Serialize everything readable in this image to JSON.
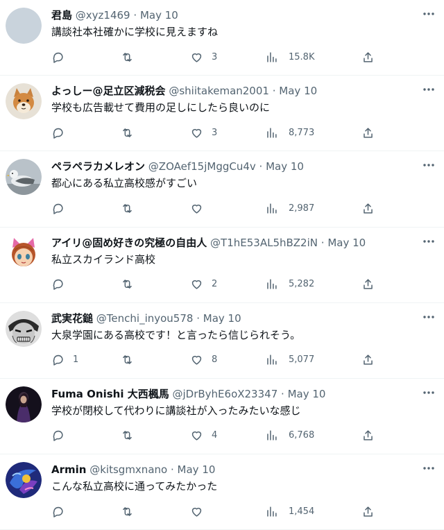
{
  "tweets": [
    {
      "name": "君島",
      "handle": "@xyz1469",
      "sep": "·",
      "date": "May 10",
      "text": "講談社本社確かに学校に見えますね",
      "replies": "",
      "retweets": "",
      "likes": "3",
      "views": "15.8K",
      "avatar": "grey-circle"
    },
    {
      "name": "よっしー@足立区減税会",
      "handle": "@shiitakeman2001",
      "sep": "·",
      "date": "May 10",
      "text": "学校も広告載せて費用の足しにしたら良いのに",
      "replies": "",
      "retweets": "",
      "likes": "3",
      "views": "8,773",
      "avatar": "shiba-dog"
    },
    {
      "name": "ペラペラカメレオン",
      "handle": "@ZOAef15jMggCu4v",
      "sep": "·",
      "date": "May 10",
      "text": "都心にある私立高校感がすごい",
      "replies": "",
      "retweets": "",
      "likes": "",
      "views": "2,987",
      "avatar": "seagull"
    },
    {
      "name": "アイリ@固め好きの究極の自由人",
      "handle": "@T1hE53AL5hBZ2iN",
      "sep": "·",
      "date": "May 10",
      "text": "私立スカイランド高校",
      "replies": "",
      "retweets": "",
      "likes": "2",
      "views": "5,282",
      "avatar": "anime-cat-girl"
    },
    {
      "name": "武実花鎚",
      "handle": "@Tenchi_inyou578",
      "sep": "·",
      "date": "May 10",
      "text": "大泉学園にある高校です！と言ったら信じられそう。",
      "replies": "1",
      "retweets": "",
      "likes": "8",
      "views": "5,077",
      "avatar": "manga-face"
    },
    {
      "name": "Fuma Onishi 大西楓馬",
      "handle": "@jDrByhE6oX23347",
      "sep": "·",
      "date": "May 10",
      "text": "学校が閉校して代わりに講談社が入ったみたいな感じ",
      "replies": "",
      "retweets": "",
      "likes": "4",
      "views": "6,768",
      "avatar": "dark-figure"
    },
    {
      "name": "Armin",
      "handle": "@kitsgmxnano",
      "sep": "·",
      "date": "May 10",
      "text": "こんな私立高校に通ってみたかった",
      "replies": "",
      "retweets": "",
      "likes": "",
      "views": "1,454",
      "avatar": "blue-art"
    }
  ],
  "colors": {
    "text": "#0f1419",
    "muted": "#536471",
    "divider": "#eff3f4"
  }
}
